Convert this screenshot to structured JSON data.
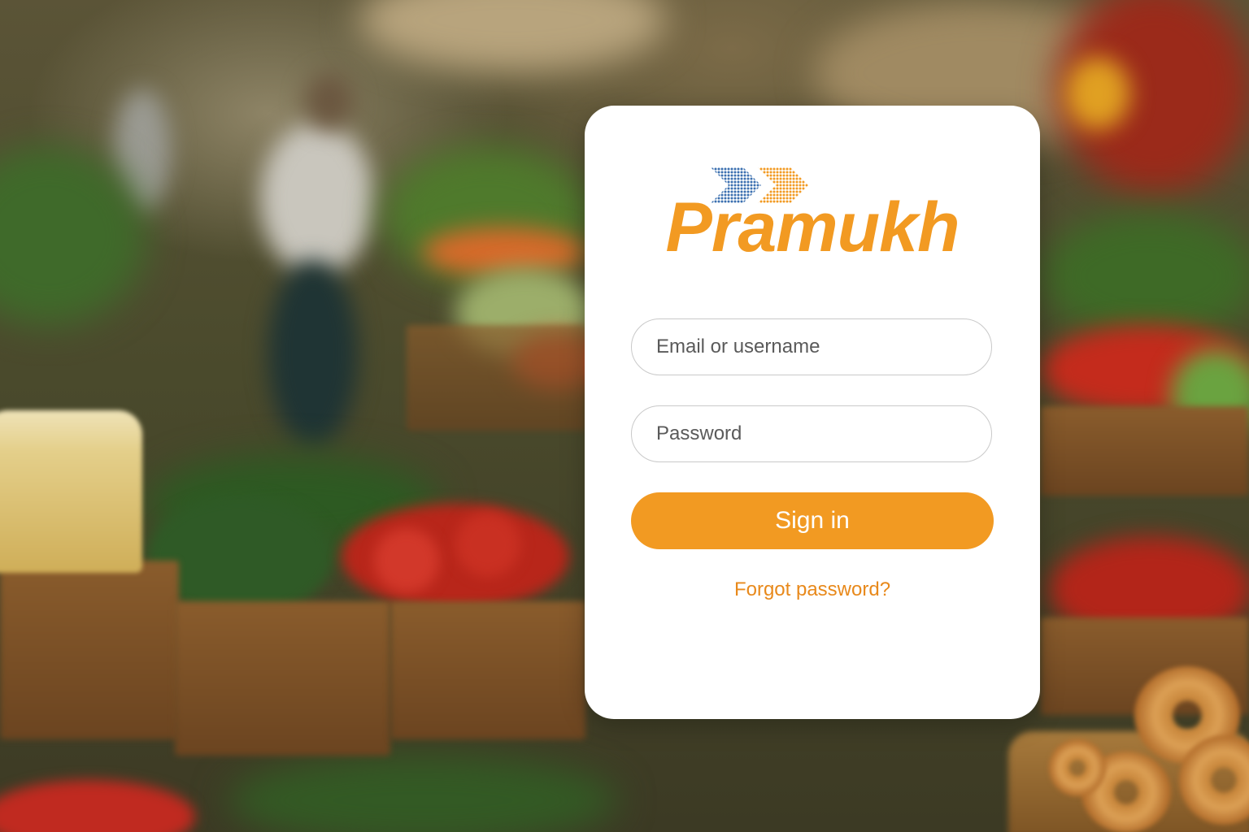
{
  "background": {
    "description_icon": "market-photo"
  },
  "logo": {
    "text": "Pramukh",
    "arrow_colors": [
      "#3b6fb0",
      "#f29a22"
    ],
    "brand_color": "#f29a22"
  },
  "form": {
    "email_placeholder": "Email or username",
    "password_placeholder": "Password",
    "signin_label": "Sign in",
    "forgot_label": "Forgot password?"
  },
  "colors": {
    "accent": "#f29a22",
    "link": "#e8891b",
    "card": "#ffffff"
  }
}
